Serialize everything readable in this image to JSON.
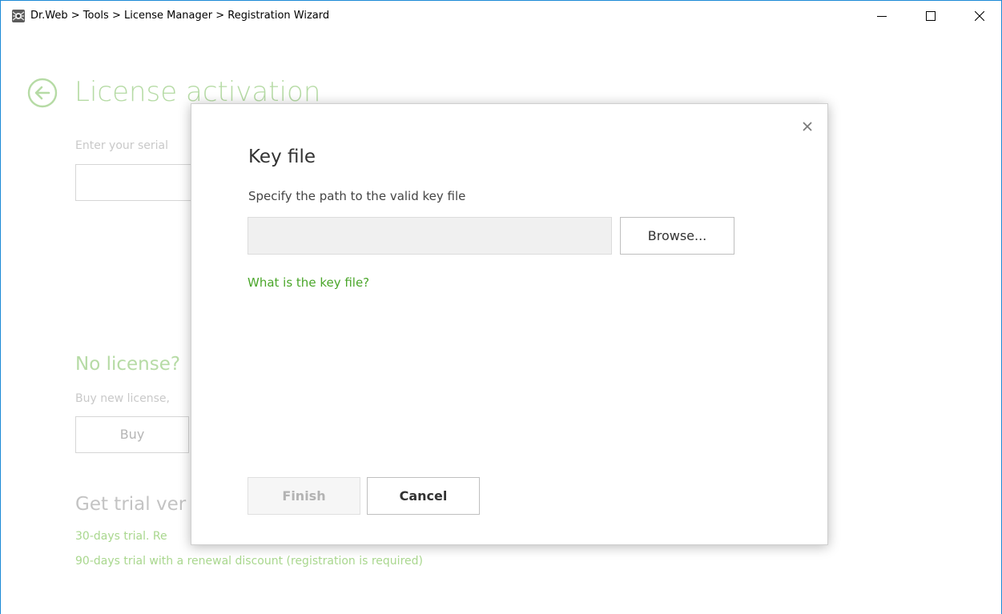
{
  "window": {
    "title": "Dr.Web > Tools > License Manager > Registration Wizard",
    "accent_color": "#1c8ad6"
  },
  "background_page": {
    "title": "License activation",
    "serial_label": "Enter your serial",
    "no_license_heading": "No license?",
    "no_license_text": "Buy new license,",
    "buy_label": "Buy",
    "trial_heading": "Get trial ver",
    "trial_link_1": "30-days trial. Re",
    "trial_link_2": "90-days trial with a renewal discount (registration is required)",
    "accent_color": "#b6dba5"
  },
  "dialog": {
    "title": "Key file",
    "subtitle": "Specify the path to the valid key file",
    "path_value": "",
    "browse_label": "Browse...",
    "help_link": "What is the key file?",
    "finish_label": "Finish",
    "cancel_label": "Cancel",
    "link_color": "#4aa62a"
  },
  "icons": {
    "app": "drweb-spider-icon",
    "minimize": "minimize-icon",
    "maximize": "maximize-icon",
    "close": "close-icon",
    "back": "back-arrow-icon",
    "dialog_close": "close-icon"
  }
}
